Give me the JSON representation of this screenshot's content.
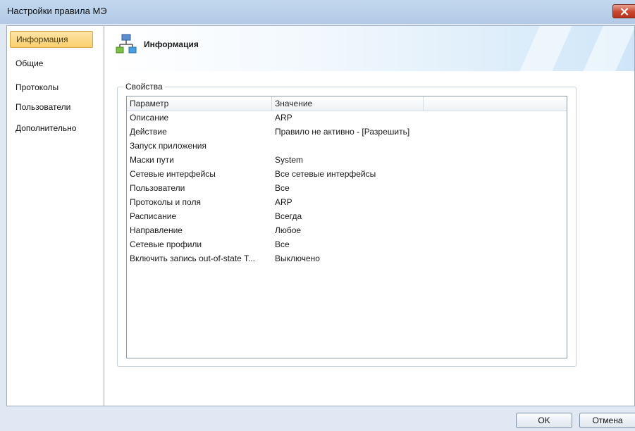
{
  "window": {
    "title": "Настройки правила МЭ"
  },
  "sidebar": {
    "items": [
      {
        "label": "Информация",
        "active": true
      },
      {
        "label": "Общие",
        "active": false
      },
      {
        "label": "Протоколы",
        "active": false
      },
      {
        "label": "Пользователи",
        "active": false
      },
      {
        "label": "Дополнительно",
        "active": false
      }
    ]
  },
  "banner": {
    "title": "Информация",
    "icon": "network-icon"
  },
  "properties": {
    "group_label": "Свойства",
    "columns": [
      "Параметр",
      "Значение"
    ],
    "rows": [
      {
        "param": "Описание",
        "value": "ARP"
      },
      {
        "param": "Действие",
        "value": "Правило не активно - [Разрешить]"
      },
      {
        "param": "Запуск приложения",
        "value": ""
      },
      {
        "param": "Маски пути",
        "value": "System"
      },
      {
        "param": "Сетевые интерфейсы",
        "value": "Все сетевые интерфейсы"
      },
      {
        "param": "Пользователи",
        "value": "Все"
      },
      {
        "param": "Протоколы и поля",
        "value": "ARP"
      },
      {
        "param": "Расписание",
        "value": "Всегда"
      },
      {
        "param": "Направление",
        "value": "Любое"
      },
      {
        "param": "Сетевые профили",
        "value": "Все"
      },
      {
        "param": "Включить запись out-of-state T...",
        "value": "Выключено"
      }
    ]
  },
  "buttons": {
    "ok": "OK",
    "cancel": "Отмена"
  },
  "colors": {
    "active_nav": "#fbcf6d",
    "close_button": "#c9462e",
    "banner_gradient_end": "#cfe6f8"
  }
}
